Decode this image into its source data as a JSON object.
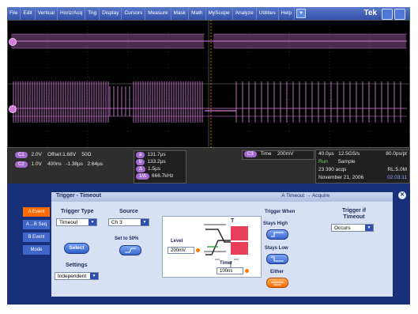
{
  "menubar": {
    "items": [
      "File",
      "Edit",
      "Vertical",
      "Horiz/Acq",
      "Trig",
      "Display",
      "Cursors",
      "Measure",
      "Mask",
      "Math",
      "MyScope",
      "Analyze",
      "Utilities",
      "Help"
    ],
    "brand": "Tek"
  },
  "readout": {
    "ch1": {
      "badge": "C1",
      "volts": "2.0V",
      "offset": "Offset:1.68V",
      "ohm": "50Ω"
    },
    "ch2": {
      "badge": "C2",
      "volts": "1.0V",
      "time": "400ns",
      "pos1": "-1.38µs",
      "pos2": "2.64µs"
    },
    "cursors": [
      {
        "badge": "a",
        "value": "131.7µs"
      },
      {
        "badge": "b",
        "value": "133.2µs"
      },
      {
        "badge": "Δ",
        "value": "1.5µs"
      },
      {
        "badge": "1/Δ",
        "value": "666.7kHz"
      }
    ],
    "time_badge": "C3",
    "time_label": "Time",
    "time_value": "200mV",
    "acq": {
      "timebase": "40.0µs",
      "rate": "12.5GS/s",
      "pt": "80.0ps/pt",
      "state": "Run",
      "mode": "Sample",
      "acqs": "23 390 acqs",
      "rl": "RL:5.0M",
      "date": "November 21, 2006",
      "clock": "02:03:11"
    }
  },
  "panel": {
    "title": "Trigger - Timeout",
    "subtitle": "A Timeout → Acquire",
    "tabs": [
      "A Event",
      "A→B Seq",
      "B Event",
      "Mode"
    ],
    "trigger_type_label": "Trigger Type",
    "trigger_type_value": "Timeout",
    "select_label": "Select",
    "settings_label": "Settings",
    "settings_value": "Independent",
    "source_label": "Source",
    "source_value": "Ch 3",
    "set50_label": "Set to 50%",
    "level_label": "Level",
    "level_value": "200mV",
    "timer_label": "Timer",
    "timer_value": "100ns",
    "diagram_T": "T",
    "trigger_when_label": "Trigger When",
    "stays_high_label": "Stays High",
    "stays_low_label": "Stays Low",
    "either_label": "Either",
    "trigger_if_label": "Trigger if\nTimeout",
    "trigger_if_value": "Occurs"
  },
  "colors": {
    "accent": "#d27bd8",
    "panel_bg": "#18307a",
    "active_tab": "#ff6a00",
    "menu": "#3350a8"
  }
}
